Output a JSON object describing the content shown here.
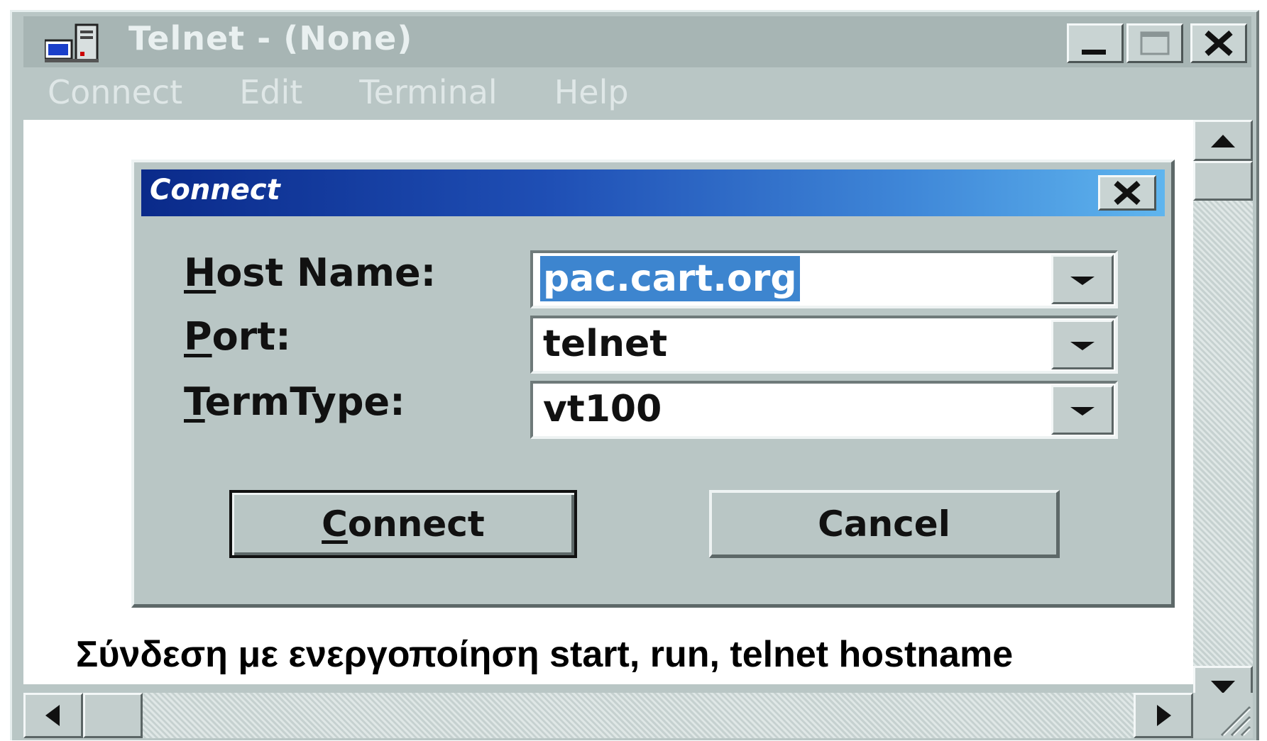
{
  "window": {
    "title": "Telnet - (None)",
    "menu": [
      "Connect",
      "Edit",
      "Terminal",
      "Help"
    ]
  },
  "dialog": {
    "title": "Connect",
    "fields": [
      {
        "label_first": "H",
        "label_rest": "ost Name:",
        "value": "pac.cart.org"
      },
      {
        "label_first": "P",
        "label_rest": "ort:",
        "value": "telnet"
      },
      {
        "label_first": "T",
        "label_rest": "ermType:",
        "value": "vt100"
      }
    ],
    "buttons": {
      "connect_first": "C",
      "connect_rest": "onnect",
      "cancel": "Cancel"
    }
  },
  "caption": "Σύνδεση με ενεργοποίηση start, run, telnet hostname",
  "icons": {
    "app": "telnet-computer-icon",
    "minimize": "minimize-icon",
    "maximize": "maximize-icon",
    "close": "close-icon",
    "dropdown": "chevron-down-icon",
    "scroll_up": "arrow-up-icon",
    "scroll_down": "arrow-down-icon",
    "scroll_left": "arrow-left-icon",
    "scroll_right": "arrow-right-icon"
  },
  "colors": {
    "window_face": "#b9c6c5",
    "dialog_title_start": "#0a2a8a",
    "dialog_title_end": "#5fb5ee",
    "selection": "#3d85cf"
  }
}
